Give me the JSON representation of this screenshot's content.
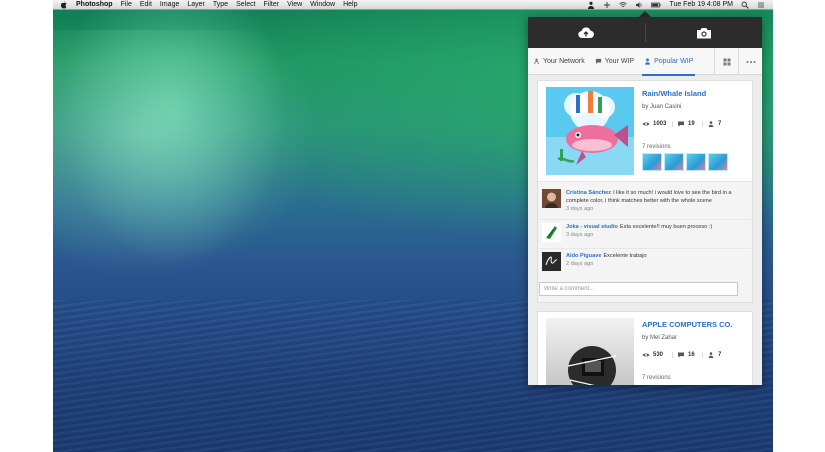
{
  "menubar": {
    "app_name": "Photoshop",
    "menus": [
      "File",
      "Edit",
      "Image",
      "Layer",
      "Type",
      "Select",
      "Filter",
      "View",
      "Window",
      "Help"
    ],
    "clock": "Tue Feb 19  4:08 PM"
  },
  "panel": {
    "tabs": [
      {
        "label": "Your Network",
        "icon": "network-icon",
        "active": false
      },
      {
        "label": "Your WIP",
        "icon": "comment-icon",
        "active": false
      },
      {
        "label": "Popular WIP",
        "icon": "person-icon",
        "active": true
      }
    ],
    "cards": [
      {
        "title": "Rain/Whale Island",
        "author": "by Juan Casini",
        "views": "1003",
        "comments": "19",
        "appreciations": "7",
        "revisions_label": "7 revisions",
        "comment_list": [
          {
            "name": "Cristina Sánchez",
            "text": "I like it so much! i would love to see the bird in a complete color, i think matches better with the whole scene",
            "time": "3 days ago"
          },
          {
            "name": "Joka - visual studio",
            "text": "Esta excelente!! muy buen proceso :)",
            "time": "3 days ago"
          },
          {
            "name": "Aldo Piguave",
            "text": "Excelente trabajo",
            "time": "2 days ago"
          }
        ],
        "comment_placeholder": "Write a comment..."
      },
      {
        "title": "APPLE COMPUTERS CO.",
        "author": "by Mel Zahar",
        "views": "530",
        "comments": "16",
        "appreciations": "7",
        "revisions_label": "7 revisions"
      }
    ]
  },
  "colors": {
    "accent": "#2a6fc8",
    "panel_dark": "#2c2c2c"
  }
}
